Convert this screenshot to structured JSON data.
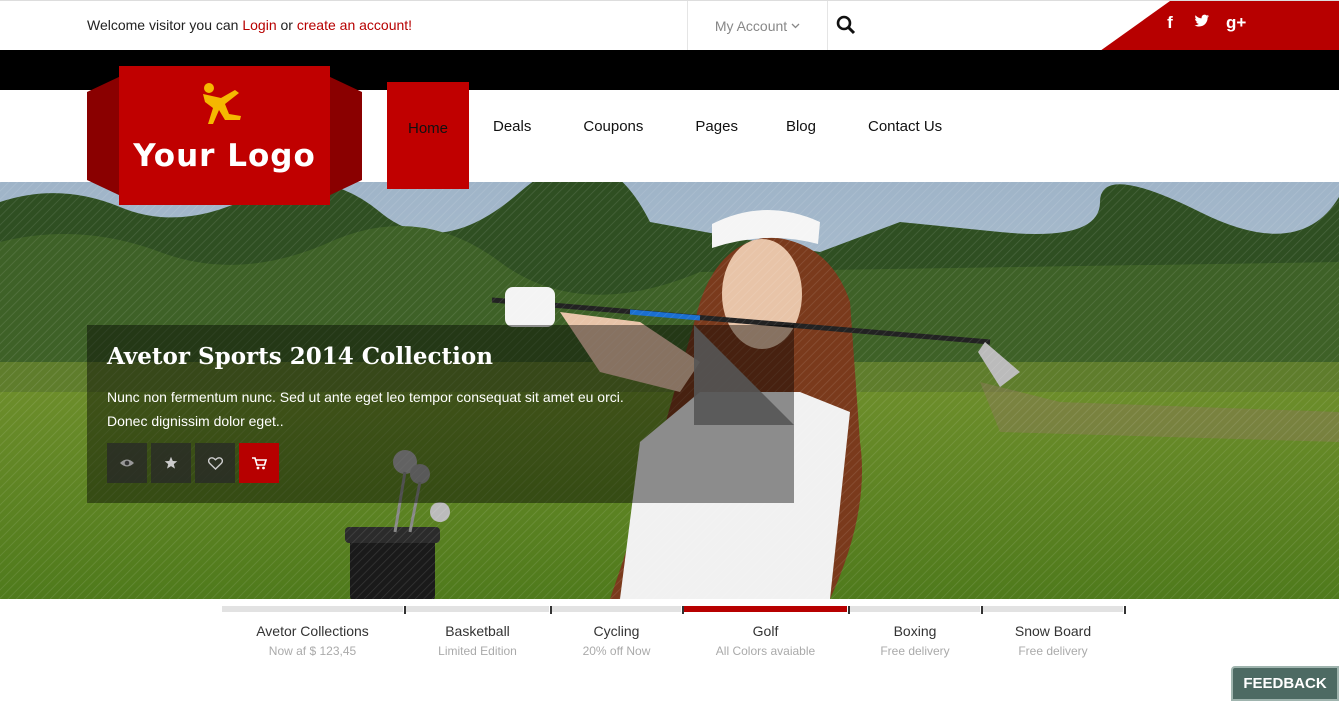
{
  "topbar": {
    "welcome_prefix": "Welcome visitor you can ",
    "login_label": "Login",
    "or_text": " or ",
    "create_account_label": "create an account!",
    "my_account_label": "My Account",
    "social": {
      "facebook": "f",
      "twitter": "t",
      "googleplus": "g+"
    }
  },
  "logo": {
    "text": "Your Logo"
  },
  "nav": {
    "items": [
      "Home",
      "Deals",
      "Coupons",
      "Pages",
      "Blog",
      "Contact Us"
    ]
  },
  "hero": {
    "title": "Avetor Sports 2014 Collection",
    "description": "Nunc non fermentum nunc. Sed ut ante eget leo tempor consequat sit amet eu orci. Donec dignissim dolor eget..",
    "buttons": [
      "eye-icon",
      "star-icon",
      "heart-icon",
      "cart-icon"
    ]
  },
  "tabs": [
    {
      "title": "Avetor Collections",
      "subtitle": "Now af $ 123,45"
    },
    {
      "title": "Basketball",
      "subtitle": "Limited Edition"
    },
    {
      "title": "Cycling",
      "subtitle": "20% off Now"
    },
    {
      "title": "Golf",
      "subtitle": "All Colors avaiable"
    },
    {
      "title": "Boxing",
      "subtitle": "Free delivery"
    },
    {
      "title": "Snow Board",
      "subtitle": "Free delivery"
    }
  ],
  "feedback": {
    "label": "FEEDBACK"
  },
  "colors": {
    "accent": "#c00000",
    "dark": "#000000"
  }
}
